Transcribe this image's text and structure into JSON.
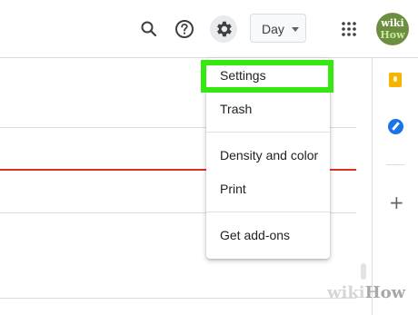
{
  "header": {
    "view_select": {
      "label": "Day"
    },
    "avatar": {
      "line1": "wiki",
      "line2": "How"
    }
  },
  "menu": {
    "items": [
      {
        "label": "Settings"
      },
      {
        "label": "Trash"
      },
      {
        "label": "Density and color"
      },
      {
        "label": "Print"
      },
      {
        "label": "Get add-ons"
      }
    ]
  },
  "colors": {
    "highlight": "#35e80f",
    "now_line": "#d93025",
    "keep": "#f4b400",
    "tasks": "#1a73e8"
  },
  "watermark": {
    "part1": "wiki",
    "part2": "How"
  }
}
